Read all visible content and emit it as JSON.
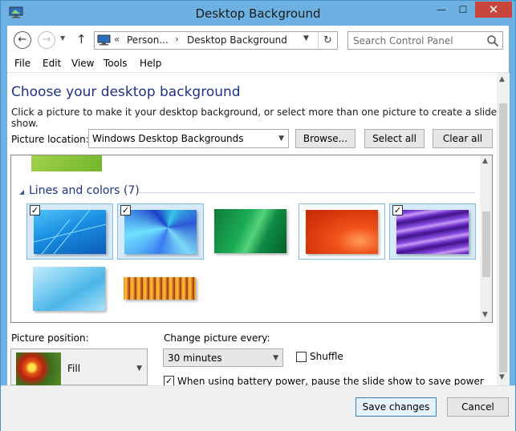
{
  "window": {
    "title": "Desktop Background"
  },
  "controls": {
    "minimize": "—",
    "maximize": "☐",
    "close": "✕"
  },
  "nav": {
    "back": "←",
    "forward": "→",
    "up": "↑",
    "refresh": "↻",
    "address": {
      "prefix": "«",
      "part1": "Person...",
      "sep": "›",
      "part2": "Desktop Background"
    },
    "search_placeholder": "Search Control Panel"
  },
  "menu": [
    "File",
    "Edit",
    "View",
    "Tools",
    "Help"
  ],
  "content": {
    "heading": "Choose your desktop background",
    "subtitle": "Click a picture to make it your desktop background, or select more than one picture to create a slide show.",
    "location_label": "Picture location:",
    "location_value": "Windows Desktop Backgrounds",
    "browse": "Browse...",
    "select_all": "Select all",
    "clear_all": "Clear all"
  },
  "gallery": {
    "group_title": "Lines and colors (7)",
    "tiles": [
      {
        "name": "blue-lines",
        "selected": true
      },
      {
        "name": "blue-balloon",
        "selected": true
      },
      {
        "name": "green-ribbon",
        "selected": false
      },
      {
        "name": "orange-swirl",
        "selected": false
      },
      {
        "name": "purple-waves",
        "selected": true
      },
      {
        "name": "light-blue-curve",
        "selected": false
      },
      {
        "name": "orange-stripes",
        "selected": false
      }
    ]
  },
  "position": {
    "label": "Picture position:",
    "value": "Fill"
  },
  "slideshow": {
    "label": "Change picture every:",
    "interval": "30 minutes",
    "shuffle": "Shuffle",
    "battery": "When using battery power, pause the slide show to save power"
  },
  "footer": {
    "save": "Save changes",
    "cancel": "Cancel"
  },
  "colors": {
    "title_bar": "#6cb1e1",
    "heading": "#1e3287",
    "close": "#c7453c"
  }
}
